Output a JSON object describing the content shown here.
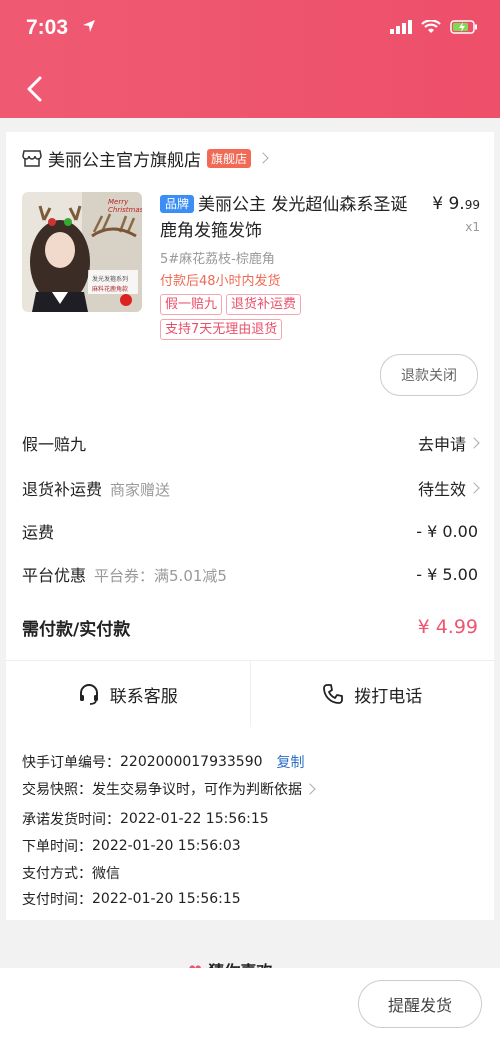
{
  "status_bar": {
    "time": "7:03"
  },
  "shop": {
    "name": "美丽公主官方旗舰店",
    "badge": "旗舰店"
  },
  "product": {
    "brand_tag": "品牌",
    "title": "美丽公主 发光超仙森系圣诞鹿角发箍发饰",
    "price_main": "¥ 9.",
    "price_cents": "99",
    "quantity": "x1",
    "sku": "5#麻花荔枝-棕鹿角",
    "ship_note": "付款后48小时内发货",
    "tags": [
      "假一赔九",
      "退货补运费",
      "支持7天无理由退货"
    ],
    "thumb_labels": [
      "Merry Christmas",
      "发光发箍系列",
      "麻料花鹿角款"
    ]
  },
  "refund_button": "退款关闭",
  "rows": {
    "fake": {
      "label": "假一赔九",
      "value": "去申请"
    },
    "return_fee": {
      "label": "退货补运费",
      "sub": "商家赠送",
      "value": "待生效"
    },
    "shipping": {
      "label": "运费",
      "value": "- ¥ 0.00"
    },
    "discount": {
      "label": "平台优惠",
      "sub": "平台券：满5.01减5",
      "value": "- ¥ 5.00"
    },
    "total": {
      "label": "需付款/实付款",
      "value": "¥ 4.99"
    }
  },
  "contact": {
    "service": "联系客服",
    "call": "拨打电话"
  },
  "order_info": {
    "order_no_label": "快手订单编号：",
    "order_no": "2202000017933590",
    "copy": "复制",
    "snapshot_label": "交易快照：",
    "snapshot_value": "发生交易争议时，可作为判断依据",
    "promise_label": "承诺发货时间：",
    "promise_value": "2022-01-22 15:56:15",
    "order_time_label": "下单时间：",
    "order_time_value": "2022-01-20 15:56:03",
    "pay_method_label": "支付方式：",
    "pay_method_value": "微信",
    "pay_time_label": "支付时间：",
    "pay_time_value": "2022-01-20 15:56:15"
  },
  "guess_title": "猜你喜欢",
  "remind_button": "提醒发货",
  "colors": {
    "header": "#ee5570",
    "accent": "#ee5570",
    "link": "#2c6fc7",
    "brand": "#3a8ef5"
  }
}
